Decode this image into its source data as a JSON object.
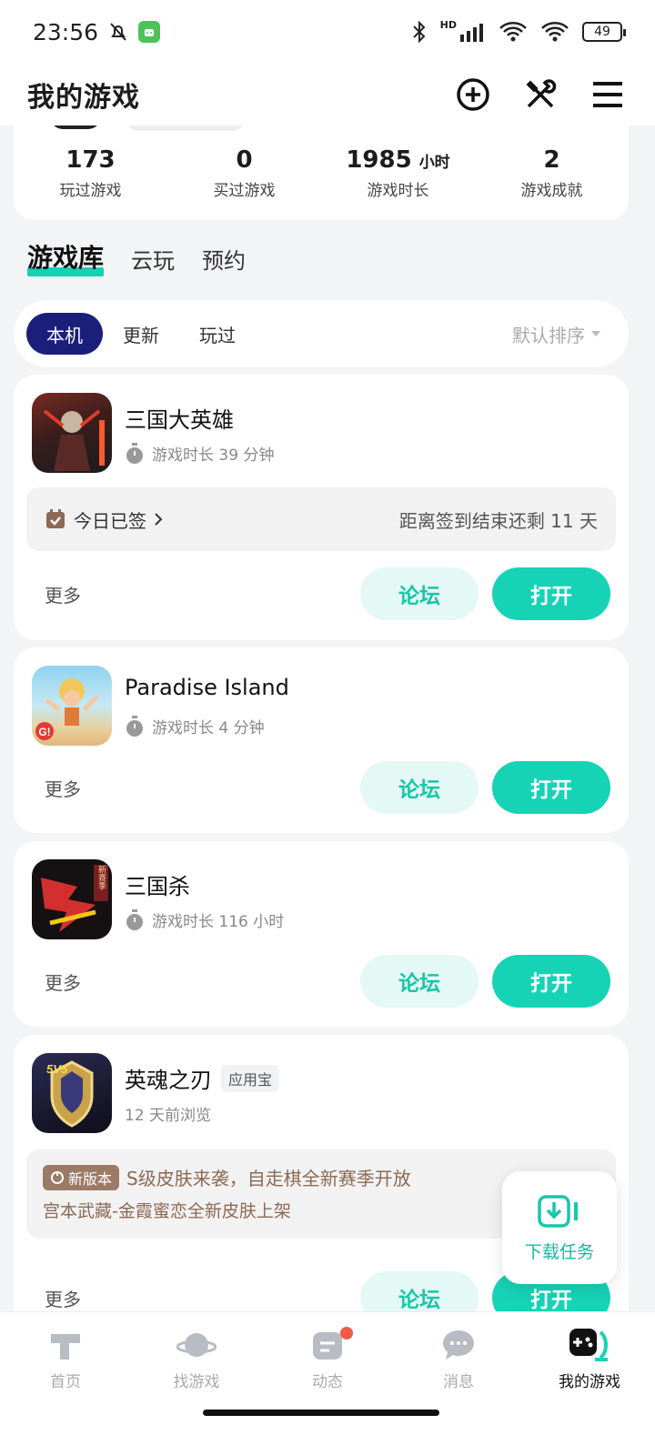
{
  "status_bar": {
    "time": "23:56",
    "battery": "49",
    "network_label": "HD"
  },
  "header": {
    "title": "我的游戏",
    "icons": [
      "add-circle-icon",
      "tools-icon",
      "menu-icon"
    ]
  },
  "stats": [
    {
      "value": "173",
      "unit": "",
      "label": "玩过游戏"
    },
    {
      "value": "0",
      "unit": "",
      "label": "买过游戏"
    },
    {
      "value": "1985",
      "unit": "小时",
      "label": "游戏时长"
    },
    {
      "value": "2",
      "unit": "",
      "label": "游戏成就"
    }
  ],
  "main_tabs": [
    {
      "label": "游戏库",
      "active": true
    },
    {
      "label": "云玩",
      "active": false
    },
    {
      "label": "预约",
      "active": false
    }
  ],
  "filters": [
    {
      "label": "本机",
      "active": true
    },
    {
      "label": "更新",
      "active": false
    },
    {
      "label": "玩过",
      "active": false
    }
  ],
  "sort_label": "默认排序",
  "games": [
    {
      "name": "三国大英雄",
      "meta": "游戏时长 39 分钟",
      "checkin_left": "今日已签",
      "checkin_right": "距离签到结束还剩 11 天",
      "more": "更多",
      "forum": "论坛",
      "open": "打开"
    },
    {
      "name": "Paradise Island",
      "meta": "游戏时长 4 分钟",
      "more": "更多",
      "forum": "论坛",
      "open": "打开"
    },
    {
      "name": "三国杀",
      "meta": "游戏时长 116 小时",
      "icon_text": "新赛季",
      "more": "更多",
      "forum": "论坛",
      "open": "打开"
    },
    {
      "name": "英魂之刃",
      "tag": "应用宝",
      "meta": "12 天前浏览",
      "icon_text": "5V5",
      "news_badge": "新版本",
      "news_title": "S级皮肤来袭，自走棋全新赛季开放",
      "news_sub": "宫本武藏-金霞蜜恋全新皮肤上架",
      "more": "更多",
      "forum": "论坛",
      "open": "打开"
    }
  ],
  "download_task": "下载任务",
  "bottom_nav": [
    {
      "label": "首页",
      "icon": "home-icon",
      "active": false
    },
    {
      "label": "找游戏",
      "icon": "planet-icon",
      "active": false
    },
    {
      "label": "动态",
      "icon": "feed-icon",
      "active": false,
      "dot": true
    },
    {
      "label": "消息",
      "icon": "message-icon",
      "active": false
    },
    {
      "label": "我的游戏",
      "icon": "gamepad-icon",
      "active": true
    }
  ],
  "colors": {
    "accent": "#16d3b6",
    "filter_active": "#1c1f7a",
    "notification_dot": "#f25a4a"
  }
}
